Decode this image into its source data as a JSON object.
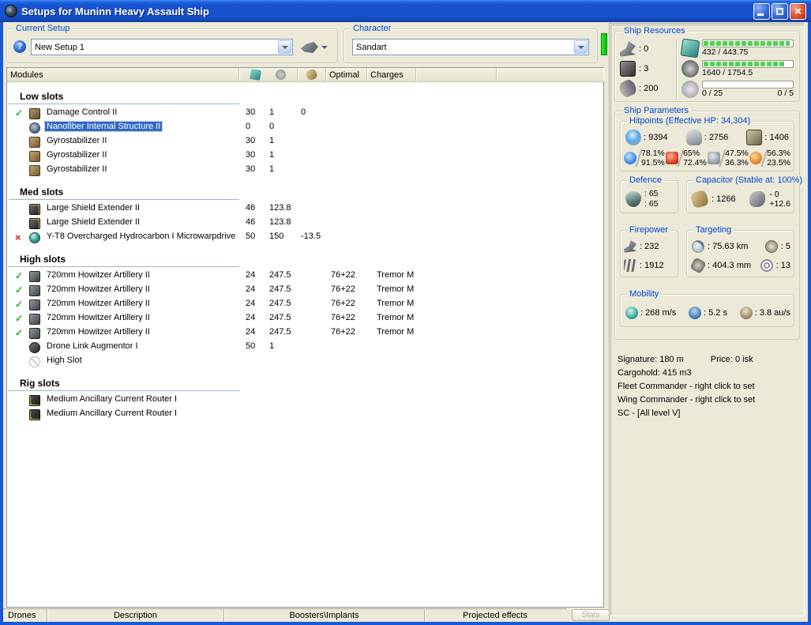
{
  "colors": {
    "titlebar_blue": "#1751cd",
    "selection_blue": "#316ac5",
    "ok_green": "#3fae3f",
    "error_red": "#cc1f1f",
    "bar_green": "#4fd44f",
    "groupbox_label_blue": "#0046d5",
    "character_status_green": "#00c400"
  },
  "window": {
    "title": "Setups for Muninn Heavy Assault Ship"
  },
  "current_setup": {
    "label": "Current Setup",
    "value": "New Setup 1"
  },
  "character": {
    "label": "Character",
    "value": "Sandart"
  },
  "modules": {
    "header": {
      "modules": "Modules",
      "optimal": "Optimal",
      "charges": "Charges"
    },
    "sections": [
      {
        "title": "Low slots",
        "rows": [
          {
            "status": "ok",
            "icon": "damage-control-icon",
            "name": "Damage Control II",
            "cpu": "30",
            "pg": "1",
            "cap": "0",
            "optimal": "",
            "charges": "",
            "selected": false
          },
          {
            "status": "",
            "icon": "nanofiber-icon",
            "name": "Nanofiber Internal Structure II",
            "cpu": "0",
            "pg": "0",
            "cap": "",
            "optimal": "",
            "charges": "",
            "selected": true
          },
          {
            "status": "",
            "icon": "gyrostabilizer-icon",
            "name": "Gyrostabilizer II",
            "cpu": "30",
            "pg": "1",
            "cap": "",
            "optimal": "",
            "charges": "",
            "selected": false
          },
          {
            "status": "",
            "icon": "gyrostabilizer-icon",
            "name": "Gyrostabilizer II",
            "cpu": "30",
            "pg": "1",
            "cap": "",
            "optimal": "",
            "charges": "",
            "selected": false
          },
          {
            "status": "",
            "icon": "gyrostabilizer-icon",
            "name": "Gyrostabilizer II",
            "cpu": "30",
            "pg": "1",
            "cap": "",
            "optimal": "",
            "charges": "",
            "selected": false
          }
        ]
      },
      {
        "title": "Med slots",
        "rows": [
          {
            "status": "",
            "icon": "shield-extender-icon",
            "name": "Large Shield Extender II",
            "cpu": "46",
            "pg": "123.8",
            "cap": "",
            "optimal": "",
            "charges": "",
            "selected": false
          },
          {
            "status": "",
            "icon": "shield-extender-icon",
            "name": "Large Shield Extender II",
            "cpu": "46",
            "pg": "123.8",
            "cap": "",
            "optimal": "",
            "charges": "",
            "selected": false
          },
          {
            "status": "error",
            "icon": "microwarpdrive-icon",
            "name": "Y-T8 Overcharged Hydrocarbon I Microwarpdrive",
            "cpu": "50",
            "pg": "150",
            "cap": "-13.5",
            "optimal": "",
            "charges": "",
            "selected": false
          }
        ]
      },
      {
        "title": "High slots",
        "rows": [
          {
            "status": "ok",
            "icon": "artillery-icon",
            "name": "720mm Howitzer Artillery II",
            "cpu": "24",
            "pg": "247.5",
            "cap": "",
            "optimal": "76+22",
            "charges": "Tremor M",
            "selected": false
          },
          {
            "status": "ok",
            "icon": "artillery-icon",
            "name": "720mm Howitzer Artillery II",
            "cpu": "24",
            "pg": "247.5",
            "cap": "",
            "optimal": "76+22",
            "charges": "Tremor M",
            "selected": false
          },
          {
            "status": "ok",
            "icon": "artillery-icon",
            "name": "720mm Howitzer Artillery II",
            "cpu": "24",
            "pg": "247.5",
            "cap": "",
            "optimal": "76+22",
            "charges": "Tremor M",
            "selected": false
          },
          {
            "status": "ok",
            "icon": "artillery-icon",
            "name": "720mm Howitzer Artillery II",
            "cpu": "24",
            "pg": "247.5",
            "cap": "",
            "optimal": "76+22",
            "charges": "Tremor M",
            "selected": false
          },
          {
            "status": "ok",
            "icon": "artillery-icon",
            "name": "720mm Howitzer Artillery II",
            "cpu": "24",
            "pg": "247.5",
            "cap": "",
            "optimal": "76+22",
            "charges": "Tremor M",
            "selected": false
          },
          {
            "status": "",
            "icon": "drone-link-icon",
            "name": "Drone Link Augmentor I",
            "cpu": "50",
            "pg": "1",
            "cap": "",
            "optimal": "",
            "charges": "",
            "selected": false
          },
          {
            "status": "",
            "icon": "empty-high-slot-icon",
            "name": "High Slot",
            "cpu": "",
            "pg": "",
            "cap": "",
            "optimal": "",
            "charges": "",
            "selected": false
          }
        ]
      },
      {
        "title": "Rig slots",
        "rows": [
          {
            "status": "",
            "icon": "rig-icon",
            "name": "Medium Ancillary Current Router I",
            "cpu": "",
            "pg": "",
            "cap": "",
            "optimal": "",
            "charges": "",
            "selected": false
          },
          {
            "status": "",
            "icon": "rig-icon",
            "name": "Medium Ancillary Current Router I",
            "cpu": "",
            "pg": "",
            "cap": "",
            "optimal": "",
            "charges": "",
            "selected": false
          }
        ]
      }
    ]
  },
  "bottom_tabs": [
    "Drones",
    "Description",
    "Boosters\\Implants",
    "Projected effects"
  ],
  "stats_button_label": "Stats",
  "ship_resources": {
    "label": "Ship Resources",
    "turrets": ": 0",
    "launchers": ": 3",
    "calibration": ": 200",
    "cpu_text": "432 / 443.75",
    "cpu_pct": 97,
    "pg_text": "1640 / 1754.5",
    "pg_pct": 93,
    "drone_bandwidth": "0 / 25",
    "drone_count": "0 / 5",
    "drone_pct": 0
  },
  "ship_parameters": {
    "label": "Ship Parameters",
    "hitpoints": {
      "label": "Hitpoints (Effective HP: 34,304)",
      "shield": ": 9394",
      "armor": ": 2756",
      "structure": ": 1406",
      "resists": [
        {
          "type": "em",
          "top": "78.1%",
          "bottom": "91.5%"
        },
        {
          "type": "thermal",
          "top": "65%",
          "bottom": "72.4%"
        },
        {
          "type": "kinetic",
          "top": "47.5%",
          "bottom": "36.3%"
        },
        {
          "type": "explosive",
          "top": "56.3%",
          "bottom": "23.5%"
        }
      ]
    },
    "defence": {
      "label": "Defence",
      "value_top": ": 65",
      "value_bottom": ": 65"
    },
    "capacitor": {
      "label": "Capacitor (Stable at: 100%)",
      "amount": ": 1266",
      "delta_top": "- 0",
      "delta_bottom": "+12.6"
    },
    "firepower": {
      "label": "Firepower",
      "dps": ": 232",
      "volley": ": 1912"
    },
    "targeting": {
      "label": "Targeting",
      "range": ": 75.63 km",
      "max_targets": ": 5",
      "scan_resolution": ": 404.3 mm",
      "sensor_strength": ": 13"
    },
    "mobility": {
      "label": "Mobility",
      "speed": ": 268 m/s",
      "align_time": ": 5.2 s",
      "warp_speed": ": 3.8 au/s"
    }
  },
  "info": {
    "signature": "Signature: 180 m",
    "price": "Price: 0 isk",
    "cargohold": "Cargohold: 415 m3",
    "fleet_commander": "Fleet Commander - right click to set",
    "wing_commander": "Wing Commander - right click to set",
    "squad_commander": "SC - [All level V]"
  }
}
